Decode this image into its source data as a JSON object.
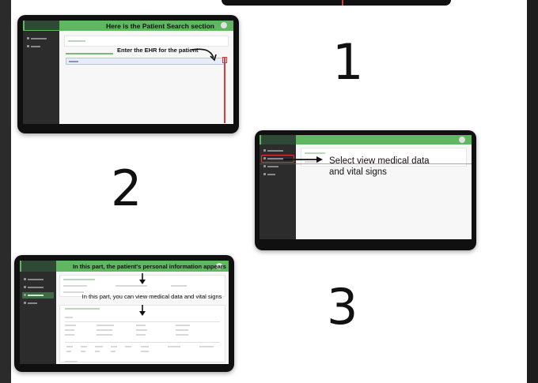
{
  "steps": [
    {
      "number": "1"
    },
    {
      "number": "2"
    },
    {
      "number": "3"
    }
  ],
  "step1": {
    "heading": "Here is the Patient Search section",
    "note": "Enter the EHR for the patient"
  },
  "step2": {
    "note": "Select view medical data and vital signs"
  },
  "step3": {
    "heading": "In this part, the patient's personal information appears",
    "note": "In this part, you can view medical data and vital signs"
  },
  "colors": {
    "header_green": "#5fb85f",
    "sidebar": "#2c2c2c",
    "highlight_red": "#e03a3a"
  }
}
